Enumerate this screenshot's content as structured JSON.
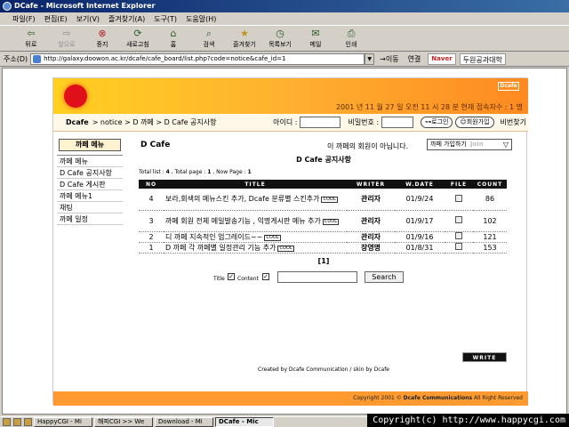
{
  "window": {
    "title": "DCafe - Microsoft Internet Explorer"
  },
  "menu": [
    "파일(F)",
    "편집(E)",
    "보기(V)",
    "즐겨찾기(A)",
    "도구(T)",
    "도움말(H)"
  ],
  "toolbar": {
    "back": "뒤로",
    "forward": "앞으로",
    "stop": "중지",
    "refresh": "새로고침",
    "home": "홈",
    "search": "검색",
    "favorites": "즐겨찾기",
    "history": "목록보기",
    "mail": "메일",
    "print": "인쇄"
  },
  "address": {
    "label": "주소(D)",
    "url": "http://galaxy.doowon.ac.kr/dcafe/cafe_board/list.php?code=notice&cafe_id=1",
    "go": "이동",
    "links": "연결",
    "naver_logo": "Naver",
    "naver_query": "두원공과대학"
  },
  "cafe": {
    "logo": "Dcafe",
    "datetime": "2001 년 11 월 27 일 오전 11 시 28 분   현재 접속자수 : 1 명",
    "breadcrumb_home": "Dcafe",
    "breadcrumb_rest": "> notice > D 까페 > D Cafe 공지사항",
    "login": {
      "id_label": "아이디 :",
      "pw_label": "비밀번호 :",
      "login_btn": "로그인",
      "join_btn": "회원가입",
      "find": "비번찾기"
    },
    "sidebar": {
      "header": "까페 메뉴",
      "items": [
        "까페 메뉴",
        "D Cafe 공지사항",
        "D Cafe 게시판",
        "까페 메뉴1",
        "채팅",
        "까페 일정"
      ]
    },
    "name": "D Cafe",
    "not_member": "이 까페의 회원이 아닙니다.",
    "join_select": "까페 가입하기",
    "join_select_en": "Join",
    "board_title": "D Cafe 공지사항",
    "stats": {
      "total_list_label": "Total list : ",
      "total_list": "4",
      "total_page_label": " , Total page : ",
      "total_page": "1",
      "now_page_label": " , Now Page : ",
      "now_page": "1"
    },
    "columns": [
      "NO",
      "TITLE",
      "WRITER",
      "W.DATE",
      "FILE",
      "COUNT"
    ],
    "rows": [
      {
        "no": "4",
        "title": "보라,회색의 메뉴스킨 추가, Dcafe 분류별 스킨추가",
        "badge": "COOL",
        "writer": "관리자",
        "date": "01/9/24",
        "count": "86"
      },
      {
        "no": "3",
        "title": "까페 회원 전체 메일발송기능 , 익명게시판 메뉴 추가",
        "badge": "COOL",
        "writer": "관리자",
        "date": "01/9/17",
        "count": "102"
      },
      {
        "no": "2",
        "title": "디 까페 지속적인 업그레이드~~",
        "badge": "COOL",
        "writer": "관리자",
        "date": "01/9/16",
        "count": "121"
      },
      {
        "no": "1",
        "title": "D 까페 각 까페별 일정관리 기능 추가",
        "badge": "COOL",
        "writer": "장영명",
        "date": "01/8/31",
        "count": "153"
      }
    ],
    "pager": "[1]",
    "search": {
      "title_label": "Title",
      "content_label": "Content",
      "button": "Search"
    },
    "write_btn": "WRITE",
    "created": "Created by Dcafe Communication / skin by Dcafe",
    "footer_prefix": "Copyright 2001 ",
    "footer_brand": "Dcafe Communications",
    "footer_suffix": " All Right Reserved"
  },
  "taskbar": {
    "items": [
      "HappyCGI - Mi",
      "해피CGI >> We",
      "Download - Mi",
      "DCafe - Mic"
    ]
  },
  "overlay": "Copyright(c) http://www.happycgi.com"
}
